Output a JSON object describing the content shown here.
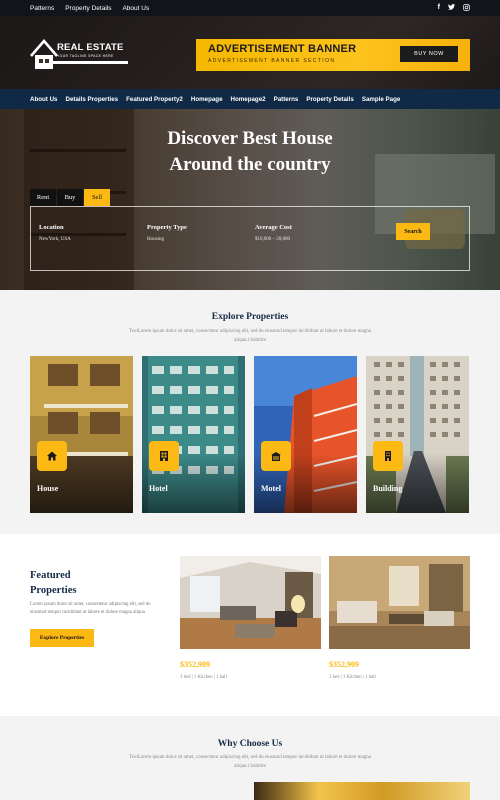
{
  "topbar": {
    "links": [
      "Patterns",
      "Property Details",
      "About Us"
    ],
    "social": [
      "f",
      "t",
      "o"
    ]
  },
  "header": {
    "logo_title": "REAL ESTATE",
    "logo_tagline": "YOUR TAGLINE SPACE HERE",
    "ad_title": "ADVERTISEMENT BANNER",
    "ad_subtitle": "ADVERTISEMENT BANNER SECTION",
    "ad_button": "BUY NOW"
  },
  "nav": {
    "items": [
      "About Us",
      "Details Properties",
      "Featured Property2",
      "Homepage",
      "Homepage2",
      "Patterns",
      "Property Details",
      "Sample Page"
    ]
  },
  "hero": {
    "title_line1": "Discover Best House",
    "title_line2": "Around the country",
    "tabs": [
      "Rent",
      "Buy",
      "Sell"
    ],
    "active_tab": "Sell",
    "fields": [
      {
        "label": "Location",
        "value": "NewYork, USA"
      },
      {
        "label": "Property Type",
        "value": "Housing"
      },
      {
        "label": "Average Cost",
        "value": "$10,000 – 20,000"
      }
    ],
    "search_button": "Search"
  },
  "explore": {
    "title": "Explore Properties",
    "subtitle": "TextLorem ipsum dolor sit amet, consectetur adipiscing elit, sed do eiusmod tempor incididunt ut labore et dolore magna aliqua.t Subtitle",
    "cards": [
      {
        "label": "House",
        "icon": "home-icon"
      },
      {
        "label": "Hotel",
        "icon": "hotel-icon"
      },
      {
        "label": "Motel",
        "icon": "motel-icon"
      },
      {
        "label": "Building",
        "icon": "building-icon"
      }
    ]
  },
  "featured": {
    "title_line1": "Featured",
    "title_line2": "Properties",
    "text": "Lorem ipsum dolor sit amet, consectetur adipiscing elit, sed do eiusmod tempor incididunt ut labore et dolore magna aliqua",
    "button": "Explore Properties",
    "properties": [
      {
        "price": "$352,909",
        "meta": "3 bed | 1 Kitchen | 1 hall"
      },
      {
        "price": "$352,909",
        "meta": "3 bed | 1 Kitchen | 1 hall"
      }
    ]
  },
  "why": {
    "title": "Why Choose Us",
    "subtitle": "TextLorem ipsum dolor sit amet, consectetur adipiscing elit, sed do eiusmod tempor incididunt ut labore et dolore magna aliqua.t Subtitle"
  },
  "colors": {
    "accent": "#fdb913",
    "nav": "#0f2946",
    "topbar": "#111418",
    "heading": "#152b47"
  }
}
